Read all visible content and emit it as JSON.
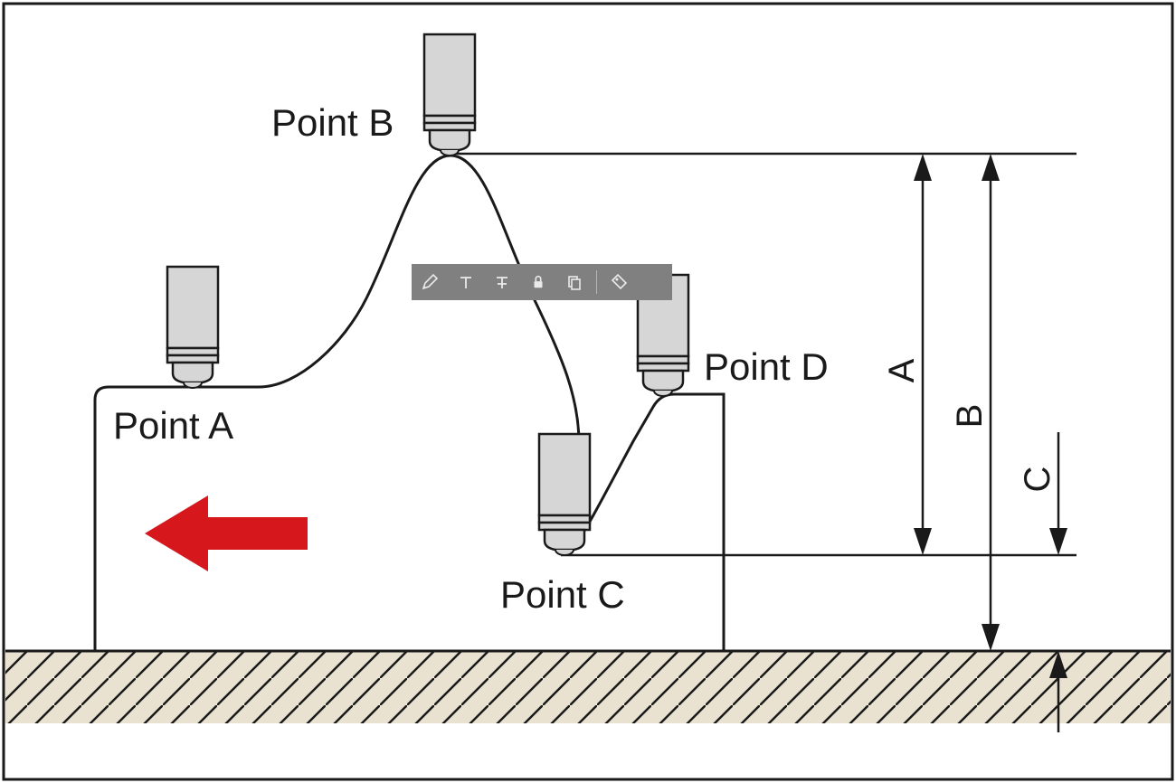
{
  "labels": {
    "pointA": "Point A",
    "pointB": "Point B",
    "pointC": "Point C",
    "pointD": "Point D",
    "dimA": "A",
    "dimB": "B",
    "dimC": "C"
  },
  "toolbar": {
    "icons": {
      "pencil": "pencil-icon",
      "text1": "text-icon",
      "text2": "text-strike-icon",
      "lock": "lock-icon",
      "copy": "copy-icon",
      "tag": "tag-icon"
    }
  },
  "diagram": {
    "description": "Tool path over contoured workpiece with dimension lines A, B, C and movement arrow"
  }
}
